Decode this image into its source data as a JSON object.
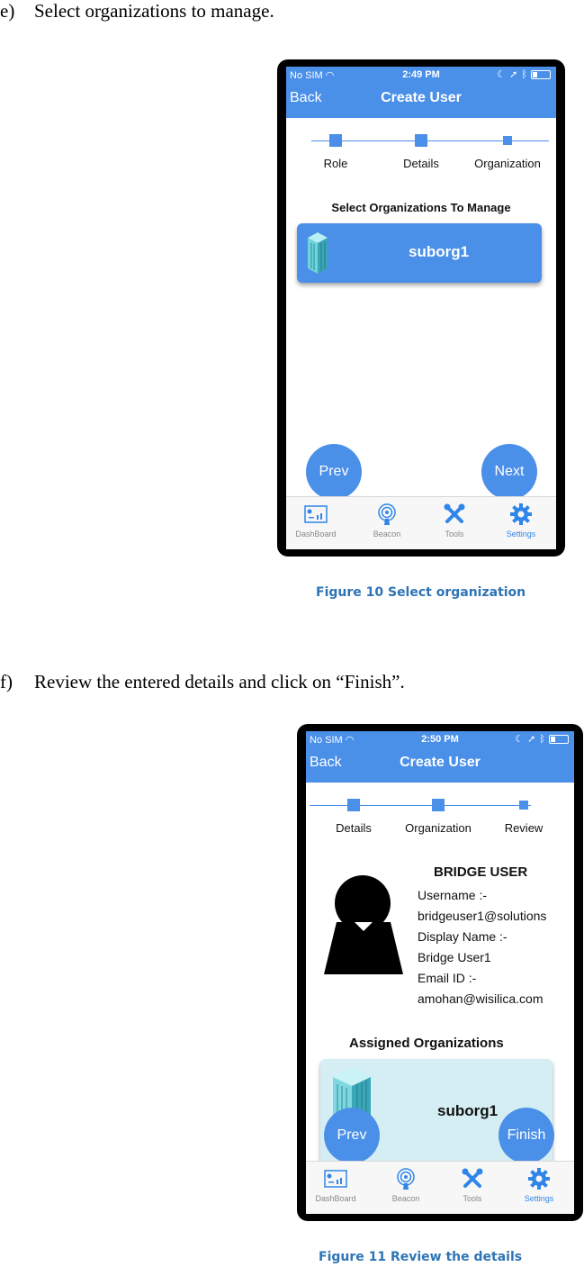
{
  "step_e": {
    "letter": "e)",
    "text": "Select organizations to manage."
  },
  "step_f": {
    "letter": "f)",
    "text": "Review the entered details and click on “Finish”."
  },
  "figure10_caption": "Figure 10 Select organization",
  "figure11_caption": "Figure 11 Review the details",
  "status_bar": {
    "carrier": "No SIM",
    "time_1": "2:49 PM",
    "time_2": "2:50 PM"
  },
  "nav": {
    "back_label": "Back",
    "title": "Create User"
  },
  "screen1": {
    "steps": [
      "Role",
      "Details",
      "Organization"
    ],
    "section_title": "Select Organizations To Manage",
    "org_name": "suborg1",
    "prev_label": "Prev",
    "next_label": "Next"
  },
  "screen2": {
    "steps": [
      "Details",
      "Organization",
      "Review"
    ],
    "user_title": "BRIDGE USER",
    "username_label": "Username :-",
    "username_value": "bridgeuser1@solutions",
    "display_name_label": "Display Name :-",
    "display_name_value": "Bridge User1",
    "email_label": "Email ID :-",
    "email_value": "amohan@wisilica.com",
    "assigned_title": "Assigned Organizations",
    "org_name": "suborg1",
    "prev_label": "Prev",
    "finish_label": "Finish"
  },
  "tabbar": {
    "items": [
      {
        "label": "DashBoard",
        "icon": "dashboard-icon"
      },
      {
        "label": "Beacon",
        "icon": "beacon-icon"
      },
      {
        "label": "Tools",
        "icon": "tools-icon"
      },
      {
        "label": "Settings",
        "icon": "settings-icon"
      }
    ],
    "active_index": 3
  },
  "colors": {
    "nav_blue": "#4a8fe8",
    "caption_blue": "#2e74b5",
    "card_blue": "#4a8fe8",
    "card_teal": "#d5eef3",
    "active_tab": "#2f86e8"
  }
}
